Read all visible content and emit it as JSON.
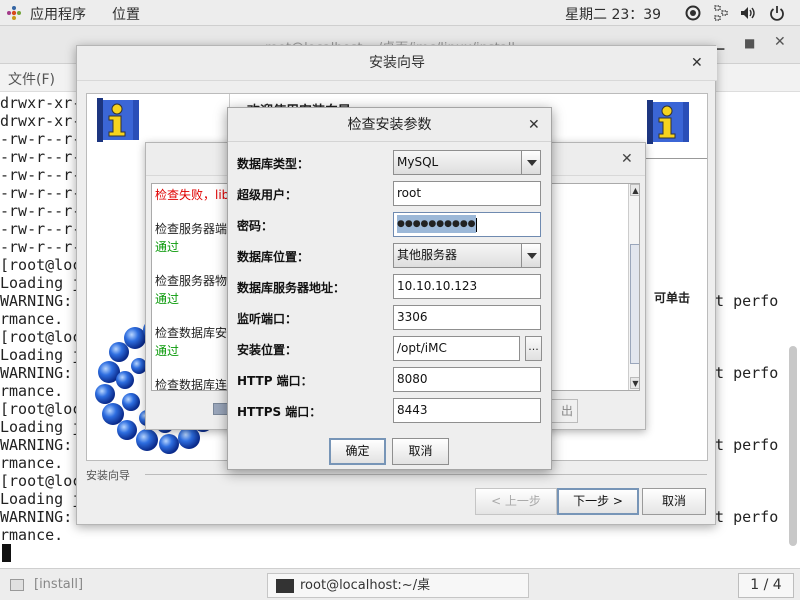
{
  "top_panel": {
    "apps_menu": "应用程序",
    "places_menu": "位置",
    "clock": "星期二 23：39"
  },
  "terminal": {
    "title": "root@localhost:~/桌面/imc/linux/install",
    "menu_file": "文件(F)",
    "lines": [
      {
        "left": "drwxr-xr-",
        "right": ""
      },
      {
        "left": "drwxr-xr-",
        "right": ""
      },
      {
        "left": "-rw-r--r-",
        "right": ""
      },
      {
        "left": "-rw-r--r-",
        "right": ""
      },
      {
        "left": "-rw-r--r-",
        "right": ""
      },
      {
        "left": "-rw-r--r-",
        "right": ""
      },
      {
        "left": "-rw-r--r-",
        "right": ""
      },
      {
        "left": "-rw-r--r-",
        "right": ""
      },
      {
        "left": "-rw-r--r-",
        "right": ""
      },
      {
        "left": "[root@loc",
        "right": ""
      },
      {
        "left": "Loading j",
        "right": ""
      },
      {
        "left": "WARNING:",
        "right": "ct perfo"
      },
      {
        "left": "rmance.",
        "right": ""
      },
      {
        "left": "[root@loc",
        "right": ""
      },
      {
        "left": "Loading j",
        "right": ""
      },
      {
        "left": "WARNING:",
        "right": "ct perfo"
      },
      {
        "left": "rmance.",
        "right": ""
      },
      {
        "left": "[root@loc",
        "right": ""
      },
      {
        "left": "Loading j",
        "right": ""
      },
      {
        "left": "WARNING:",
        "right": "ct perfo"
      },
      {
        "left": "rmance.",
        "right": ""
      },
      {
        "left": "[root@loc",
        "right": ""
      },
      {
        "left": "Loading j",
        "right": ""
      },
      {
        "left": "WARNING:",
        "right": "ct perfo"
      },
      {
        "left": "rmance.",
        "right": ""
      }
    ]
  },
  "wizard": {
    "title": "安装向导",
    "welcome": "欢迎使用安装向导",
    "side_text": "可单击",
    "section_label": "安装向导",
    "prev_label": "< 上一步",
    "next_label": "下一步 >",
    "cancel_label": "取消"
  },
  "check_dialog": {
    "items": [
      {
        "text": "检查失败，lib",
        "status": "fail"
      },
      {
        "text": "检查服务器端",
        "status": "label"
      },
      {
        "text": "通过",
        "status": "ok"
      },
      {
        "text": "检查服务器物",
        "status": "label"
      },
      {
        "text": "通过",
        "status": "ok"
      },
      {
        "text": "检查数据库安",
        "status": "label"
      },
      {
        "text": "通过",
        "status": "ok"
      },
      {
        "text": "检查数据库连",
        "status": "label"
      }
    ],
    "partial_button": "出"
  },
  "params_dialog": {
    "title": "检查安装参数",
    "db_type_label": "数据库类型：",
    "db_type_value": "MySQL",
    "superuser_label": "超级用户：",
    "superuser_value": "root",
    "password_label": "密码：",
    "password_masked": "●●●●●●●●●●",
    "db_location_label": "数据库位置：",
    "db_location_value": "其他服务器",
    "db_server_label": "数据库服务器地址：",
    "db_server_value": "10.10.10.123",
    "port_label": "监听端口：",
    "port_value": "3306",
    "install_location_label": "安装位置：",
    "install_location_value": "/opt/iMC",
    "browse_label": "...",
    "http_label": "HTTP 端口：",
    "http_value": "8080",
    "https_label": "HTTPS 端口：",
    "https_value": "8443",
    "ok_label": "确定",
    "cancel_label": "取消"
  },
  "taskbar": {
    "task_install": "[install]",
    "task_terminal": "root@localhost:~/桌面/imc/linux/in···",
    "workspace": "1 / 4"
  }
}
